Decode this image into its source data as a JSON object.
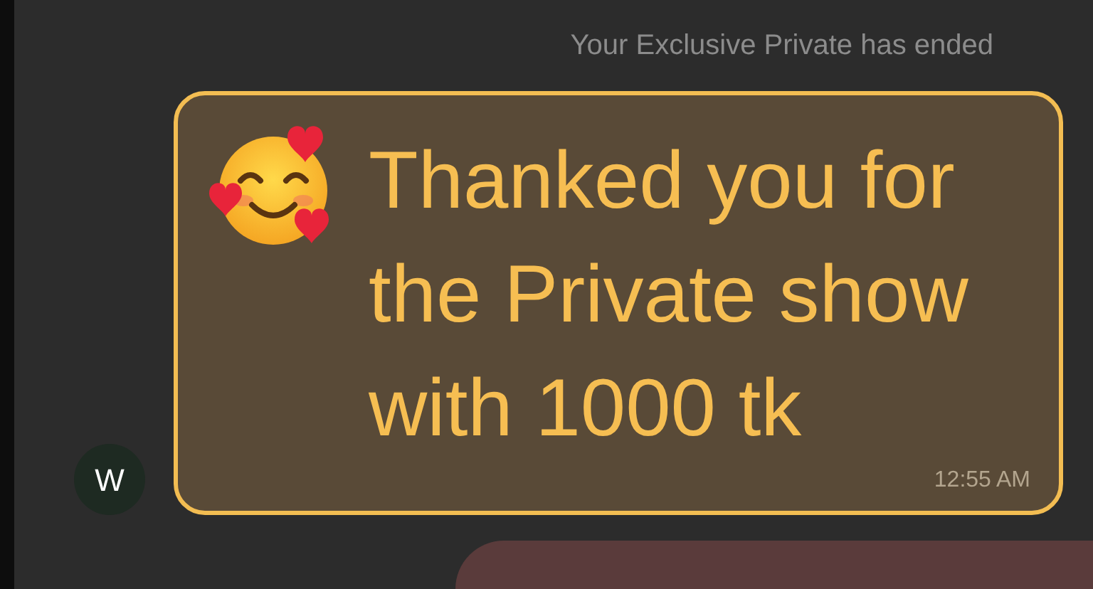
{
  "system_message": "Your Exclusive Private has ended",
  "message": {
    "sender_initial": "W",
    "text": "Thanked you for the Private show with 1000 tk",
    "time": "12:55 AM"
  }
}
